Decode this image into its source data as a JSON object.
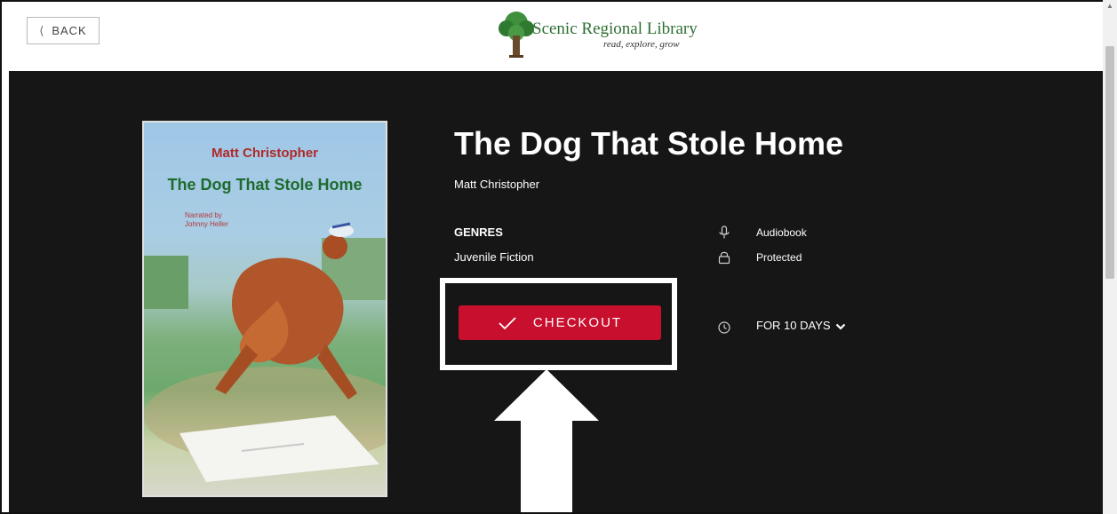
{
  "header": {
    "back_label": "BACK",
    "library_name": "Scenic Regional Library",
    "tagline": "read, explore, grow"
  },
  "book": {
    "title": "The Dog That Stole Home",
    "author": "Matt Christopher",
    "genres_heading": "GENRES",
    "genre": "Juvenile Fiction",
    "format": "Audiobook",
    "protection": "Protected"
  },
  "cover": {
    "author": "Matt Christopher",
    "title": "The Dog That Stole Home",
    "narrated_by": "Narrated by",
    "narrator": "Johnny Heller"
  },
  "actions": {
    "checkout_label": "CHECKOUT",
    "duration_label": "FOR 10 DAYS"
  },
  "icons": {
    "back": "chevron-left-icon",
    "logo": "tree-logo-icon",
    "format": "microphone-icon",
    "protection": "lock-icon",
    "duration": "clock-icon",
    "checkout": "checkmark-icon",
    "duration_toggle": "chevron-down-icon"
  },
  "colors": {
    "checkout_button": "#c8102e",
    "page_background": "#161616",
    "logo_green": "#2f6f33"
  }
}
